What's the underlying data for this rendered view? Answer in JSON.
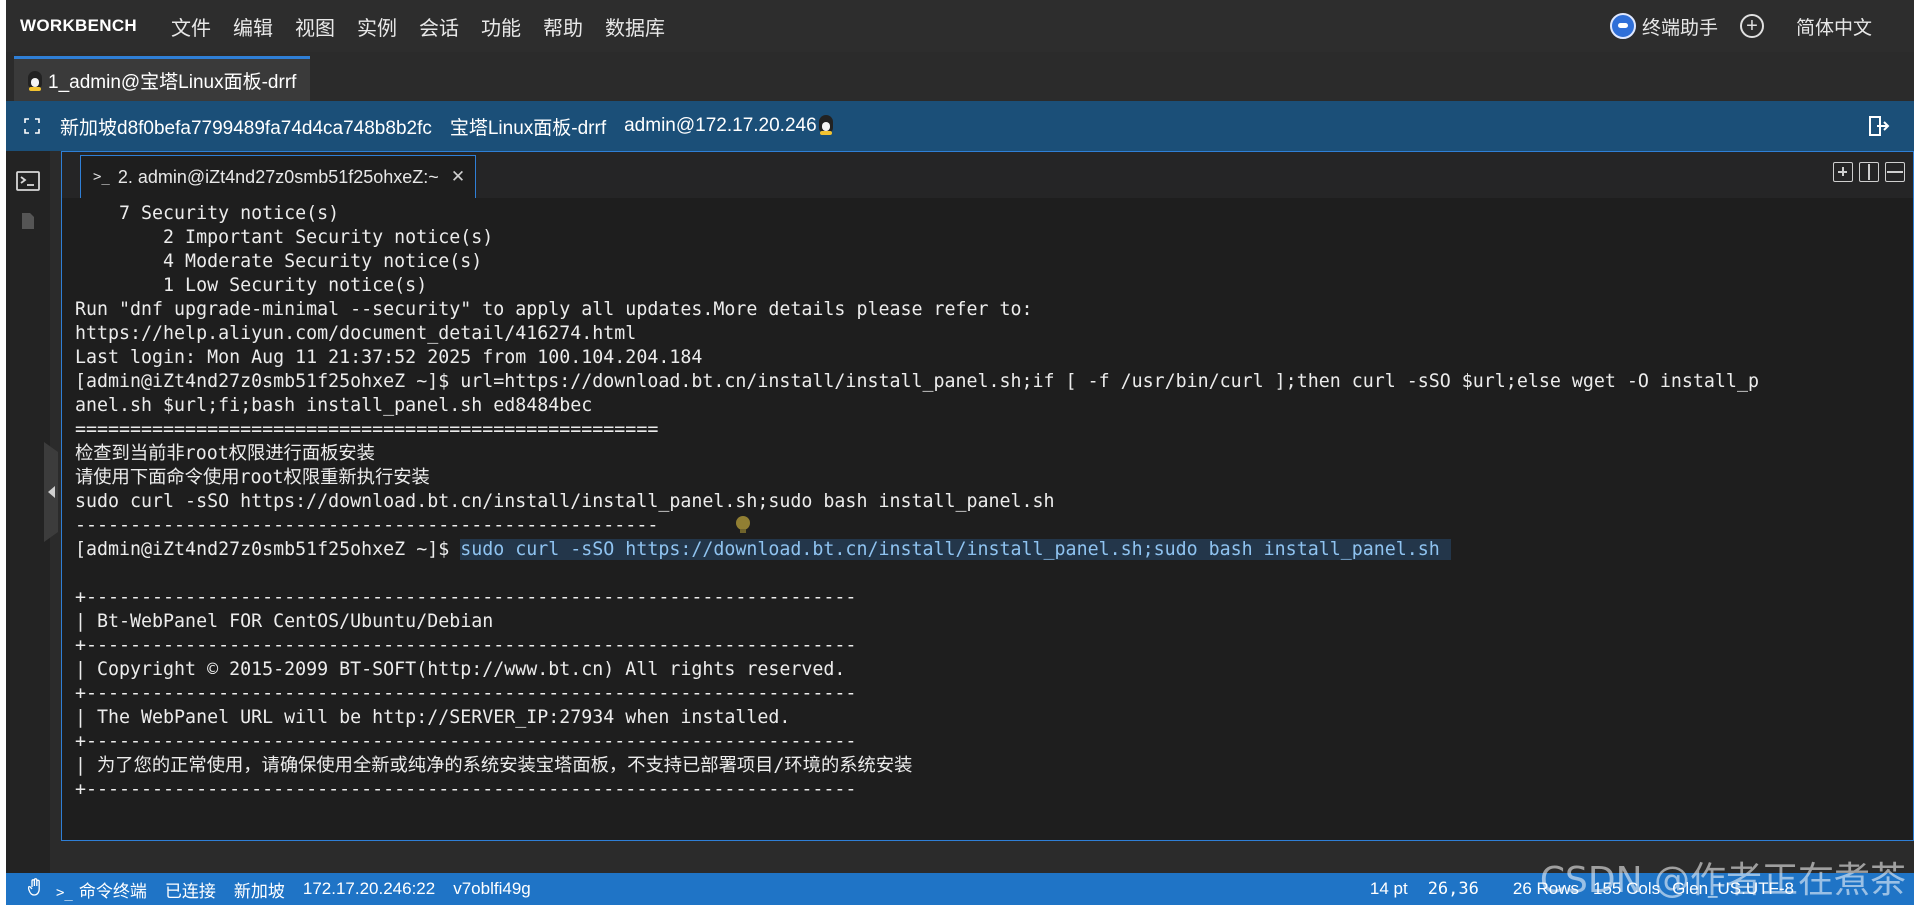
{
  "menubar": {
    "brand": "WORKBENCH",
    "items": [
      "文件",
      "编辑",
      "视图",
      "实例",
      "会话",
      "功能",
      "帮助",
      "数据库"
    ],
    "assistant_label": "终端助手",
    "language_label": "简体中文"
  },
  "session_tab": {
    "label": "1_admin@宝塔Linux面板-drrf"
  },
  "infobar": {
    "region_instance": "新加坡d8f0befa7799489fa74d4ca748b8b2fc",
    "instance_name": "宝塔Linux面板-drrf",
    "connection": "admin@172.17.20.246"
  },
  "terminal": {
    "tab_label": "2. admin@iZt4nd27z0smb51f25ohxeZ:~",
    "prompt": "[admin@iZt4nd27z0smb51f25ohxeZ ~]$ ",
    "highlighted_command": "sudo curl -sSO https://download.bt.cn/install/install_panel.sh;sudo bash install_panel.sh ",
    "lines": [
      "    7 Security notice(s)",
      "        2 Important Security notice(s)",
      "        4 Moderate Security notice(s)",
      "        1 Low Security notice(s)",
      "Run \"dnf upgrade-minimal --security\" to apply all updates.More details please refer to:",
      "https://help.aliyun.com/document_detail/416274.html",
      "Last login: Mon Aug 11 21:37:52 2025 from 100.104.204.184",
      "[admin@iZt4nd27z0smb51f25ohxeZ ~]$ url=https://download.bt.cn/install/install_panel.sh;if [ -f /usr/bin/curl ];then curl -sSO $url;else wget -O install_p",
      "anel.sh $url;fi;bash install_panel.sh ed8484bec",
      "=====================================================",
      "检查到当前非root权限进行面板安装",
      "请使用下面命令使用root权限重新执行安装",
      "sudo curl -sSO https://download.bt.cn/install/install_panel.sh;sudo bash install_panel.sh",
      "-----------------------------------------------------",
      "",
      "",
      "+----------------------------------------------------------------------",
      "| Bt-WebPanel FOR CentOS/Ubuntu/Debian",
      "+----------------------------------------------------------------------",
      "| Copyright © 2015-2099 BT-SOFT(http://www.bt.cn) All rights reserved.",
      "+----------------------------------------------------------------------",
      "| The WebPanel URL will be http://SERVER_IP:27934 when installed.",
      "+----------------------------------------------------------------------",
      "| 为了您的正常使用，请确保使用全新或纯净的系统安装宝塔面板，不支持已部署项目/环境的系统安装",
      "+----------------------------------------------------------------------"
    ]
  },
  "statusbar": {
    "mode": "命令终端",
    "state": "已连接",
    "region": "新加坡",
    "address": "172.17.20.246:22",
    "session_id": "v7oblfi49g",
    "font_size": "14 pt",
    "cursor": "26,36",
    "rows": "26 Rows",
    "cols": "155 Cols",
    "encoding": "Glen_US.UTF-8"
  },
  "watermark": "CSDN @作者正在煮茶",
  "colors": {
    "menubar_bg": "#2d2d2d",
    "infobar_bg": "#1b4f78",
    "statusbar_bg": "#1f74c6",
    "terminal_bg": "#1e1e1e",
    "accent": "#2f7fd6",
    "command_highlight_bg": "#23364a",
    "command_highlight_fg": "#8fc3f0"
  },
  "icons": [
    "expand-icon",
    "linux-penguin-icon",
    "exit-icon",
    "terminal-icon",
    "file-icon",
    "assistant-icon",
    "add-circle-icon",
    "close-icon",
    "new-pane-icon",
    "split-vertical-icon",
    "split-horizontal-icon",
    "hand-icon",
    "lightbulb-icon"
  ]
}
